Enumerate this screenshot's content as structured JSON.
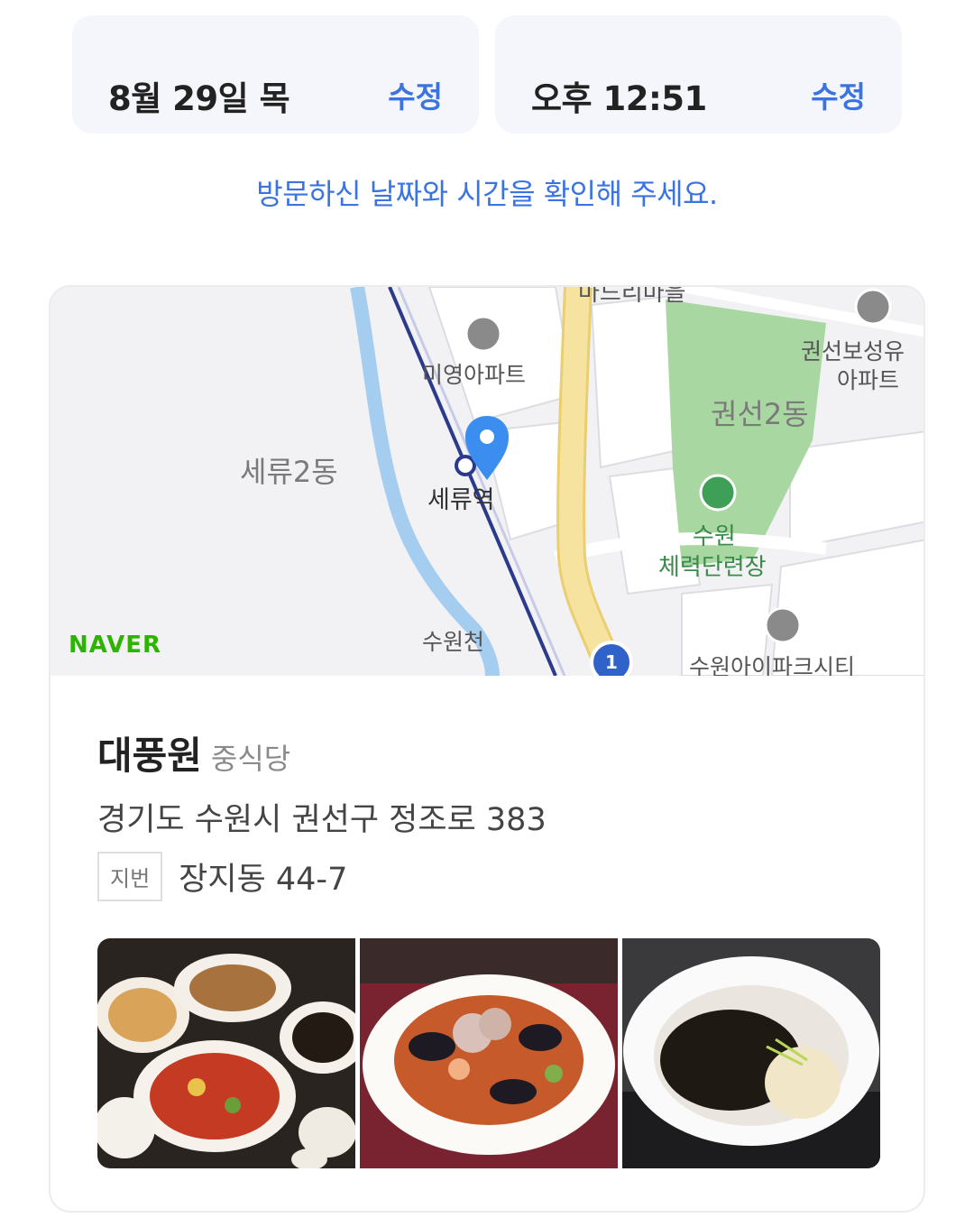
{
  "date": {
    "value": "8월 29일 목",
    "edit_label": "수정"
  },
  "time": {
    "value": "오후 12:51",
    "edit_label": "수정"
  },
  "notice": "방문하신 날짜와 시간을 확인해 주세요.",
  "map": {
    "brand": "NAVER",
    "labels": {
      "mi_young_apt": "미영아파트",
      "seryu2dong": "세류2동",
      "seryu_station": "세류역",
      "gwonseon2dong": "권선2동",
      "gwonseon_apt_line1": "권선보성유",
      "gwonseon_apt_line2": "아파트",
      "suwon_line1": "수원",
      "suwon_line2": "체력단련장",
      "suwoncheon": "수원천",
      "ipark": "수원아이파크시티",
      "top_cut": "마드리마을",
      "route_number": "1"
    }
  },
  "place": {
    "name": "대풍원",
    "category": "중식당",
    "address": "경기도 수원시 권선구 정조로 383",
    "jibun_label": "지번",
    "jibun_value": "장지동 44-7"
  },
  "photos": [
    "chinese-banquet-dishes",
    "jjamppong-with-octopus",
    "jjajangmyeon"
  ],
  "colors": {
    "accent": "#3b73e0",
    "naver_green": "#2db400",
    "map_road_yellow": "#f7e3a0",
    "map_park": "#a9d7a1",
    "map_river": "#a5cdf0"
  }
}
